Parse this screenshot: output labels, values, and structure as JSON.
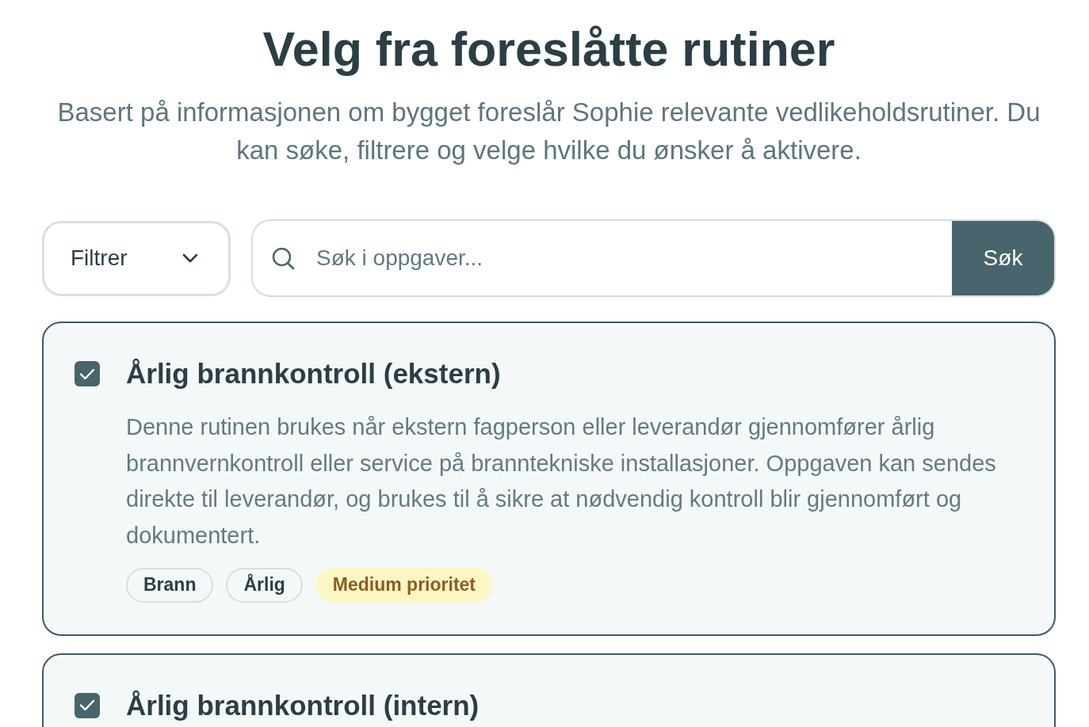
{
  "header": {
    "title": "Velg fra foreslåtte rutiner",
    "subtitle": "Basert på informasjonen om bygget foreslår Sophie relevante vedlikeholdsrutiner. Du kan søke, filtrere og velge hvilke du ønsker å aktivere."
  },
  "toolbar": {
    "filter": {
      "label": "Filtrer"
    },
    "search": {
      "placeholder": "Søk i oppgaver...",
      "button": "Søk"
    }
  },
  "routines": [
    {
      "title": "Årlig brannkontroll (ekstern)",
      "checked": true,
      "description": "Denne rutinen brukes når ekstern fagperson eller leverandør gjennomfører årlig brannvernkontroll eller service på branntekniske installasjoner. Oppgaven kan sendes direkte til leverandør, og brukes til å sikre at nødvendig kontroll blir gjennomført og dokumentert.",
      "tags": [
        {
          "label": "Brann",
          "kind": "category"
        },
        {
          "label": "Årlig",
          "kind": "category"
        },
        {
          "label": "Medium prioritet",
          "kind": "priority"
        }
      ]
    },
    {
      "title": "Årlig brannkontroll (intern)",
      "checked": true
    }
  ]
}
